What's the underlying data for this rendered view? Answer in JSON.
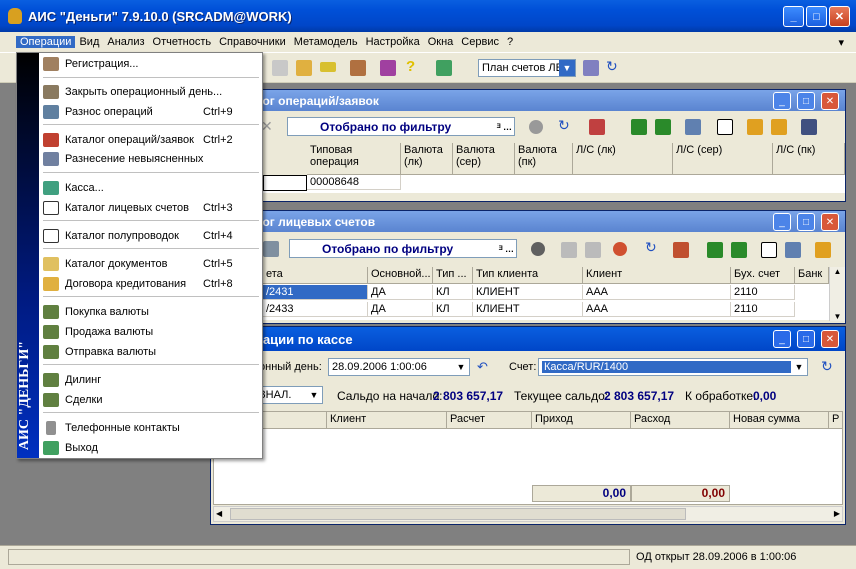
{
  "window": {
    "title": "АИС \"Деньги\" 7.9.10.0 (SRCADM@WORK)"
  },
  "menubar": [
    "Операции",
    "Вид",
    "Анализ",
    "Отчетность",
    "Справочники",
    "Метамодель",
    "Настройка",
    "Окна",
    "Сервис",
    "?"
  ],
  "toolbar": {
    "plan_combo": "План счетов ЛЕ"
  },
  "win_ops": {
    "title": "лог операций/заявок",
    "filter": "Отобрано по фильтру",
    "columns": [
      "Типовая операция",
      "Валюта (лк)",
      "Валюта (сер)",
      "Валюта (пк)",
      "Л/С (лк)",
      "Л/С (сер)",
      "Л/С (пк)"
    ],
    "row": [
      "00008648"
    ]
  },
  "win_accounts": {
    "title": "лог лицевых счетов",
    "filter": "Отобрано по фильтру",
    "columns": [
      "ета",
      "Основной...",
      "Тип ...",
      "Тип клиента",
      "Клиент",
      "Бух. счет",
      "Банк"
    ],
    "rows": [
      [
        "/2431",
        "ДА",
        "КЛ",
        "КЛИЕНТ",
        "AAA",
        "2110"
      ],
      [
        "/2433",
        "ДА",
        "КЛ",
        "КЛИЕНТ",
        "AAA",
        "2110"
      ]
    ]
  },
  "win_cash": {
    "title": "рации по кассе",
    "day_label": "онный день:",
    "day_value": "28.09.2006 1:00:06",
    "account_label": "Счет:",
    "account_value": "Касса/RUR/1400",
    "journal": "ЗНАЛ.",
    "open_balance_label": "Сальдо на начало:",
    "open_balance": "2 803 657,17",
    "current_balance_label": "Текущее сальдо:",
    "current_balance": "2 803 657,17",
    "to_process_label": "К обработке:",
    "to_process": "0,00",
    "columns": [
      "Клиент",
      "Расчет",
      "Приход",
      "Расход",
      "Новая сумма",
      "Р"
    ],
    "total_in": "0,00",
    "total_out": "0,00"
  },
  "menu": {
    "side_label": "АИС \"ДЕНЬГИ\"",
    "items": [
      {
        "label": "Регистрация...",
        "shortcut": ""
      },
      {
        "label": "Закрыть операционный день...",
        "shortcut": ""
      },
      {
        "label": "Разнос операций",
        "shortcut": "Ctrl+9"
      },
      {
        "label": "Каталог операций/заявок",
        "shortcut": "Ctrl+2"
      },
      {
        "label": "Разнесение невыясненных",
        "shortcut": ""
      },
      {
        "label": "Касса...",
        "shortcut": ""
      },
      {
        "label": "Каталог лицевых счетов",
        "shortcut": "Ctrl+3"
      },
      {
        "label": "Каталог полупроводок",
        "shortcut": "Ctrl+4"
      },
      {
        "label": "Каталог документов",
        "shortcut": "Ctrl+5"
      },
      {
        "label": "Договора кредитования",
        "shortcut": "Ctrl+8"
      },
      {
        "label": "Покупка валюты",
        "shortcut": ""
      },
      {
        "label": "Продажа валюты",
        "shortcut": ""
      },
      {
        "label": "Отправка валюты",
        "shortcut": ""
      },
      {
        "label": "Дилинг",
        "shortcut": ""
      },
      {
        "label": "Сделки",
        "shortcut": ""
      },
      {
        "label": "Телефонные контакты",
        "shortcut": ""
      },
      {
        "label": "Выход",
        "shortcut": ""
      }
    ]
  },
  "status": {
    "text": "ОД открыт 28.09.2006 в 1:00:06"
  }
}
